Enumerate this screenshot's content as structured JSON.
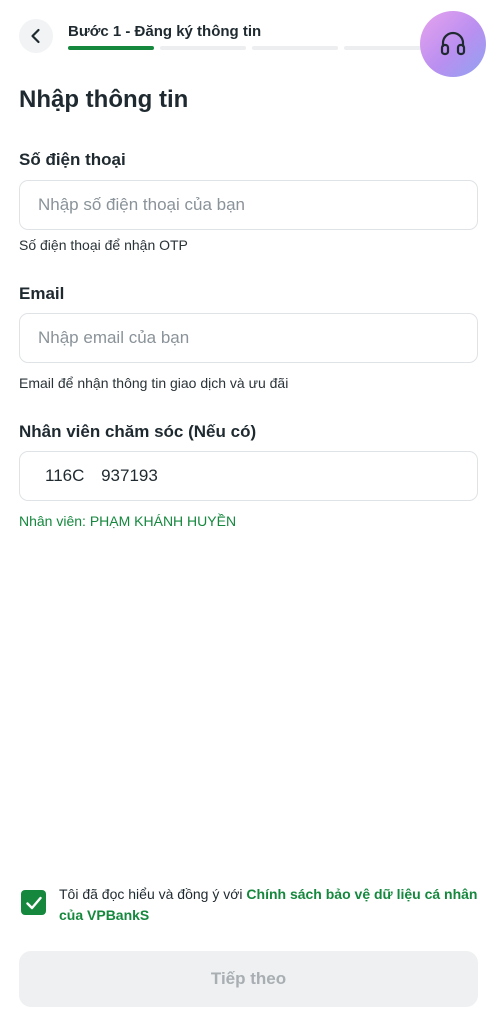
{
  "header": {
    "step_title": "Bước 1 - Đăng ký thông tin",
    "progress": {
      "current_step": 1,
      "total_steps": 4
    },
    "back_icon": "chevron-left-icon",
    "support_icon": "headset-icon"
  },
  "page": {
    "title": "Nhập thông tin"
  },
  "phone": {
    "label": "Số điện thoại",
    "placeholder": "Nhập số điện thoại của bạn",
    "value": "",
    "helper": "Số điện thoại để nhận OTP"
  },
  "email": {
    "label": "Email",
    "placeholder": "Nhập email của bạn",
    "value": "",
    "helper": "Email để nhận thông tin giao dịch và ưu đãi"
  },
  "staff": {
    "label": "Nhân viên chăm sóc (Nếu có)",
    "value": "116C 937193",
    "name_text": "Nhân viên: PHẠM KHÁNH HUYỀN"
  },
  "consent": {
    "checked": true,
    "text": "Tôi đã đọc hiểu và đồng ý với ",
    "link_text": "Chính sách bảo vệ dữ liệu cá nhân của VPBankS"
  },
  "next_button": {
    "label": "Tiếp theo",
    "enabled": false
  },
  "colors": {
    "accent": "#15883e",
    "text": "#1f2a30",
    "border": "#dfe3e6",
    "disabled_bg": "#eef0f1",
    "disabled_text": "#a8aeb2"
  }
}
